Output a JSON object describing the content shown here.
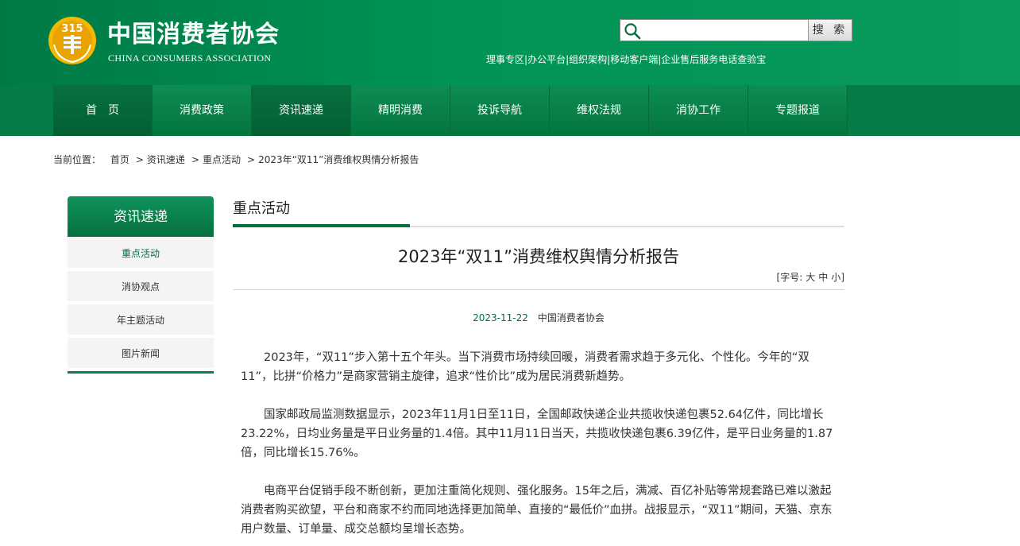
{
  "header": {
    "logo_cn": "中国消费者协会",
    "logo_en": "CHINA CONSUMERS ASSOCIATION",
    "search_placeholder": "",
    "search_button": "搜 索",
    "top_links": [
      "理事专区",
      "办公平台",
      "组织架构",
      "移动客户端",
      "企业售后服务电话查验宝"
    ],
    "separator": "|"
  },
  "nav": {
    "items": [
      "首　页",
      "消费政策",
      "资讯速递",
      "精明消费",
      "投诉导航",
      "维权法规",
      "消协工作",
      "专题报道"
    ],
    "active_index": 2
  },
  "breadcrumb": {
    "prefix": "当前位置：",
    "items": [
      "首页",
      "资讯速递",
      "重点活动",
      "2023年“双11”消费维权舆情分析报告"
    ],
    "separator": ">"
  },
  "sidebar": {
    "title": "资讯速递",
    "items": [
      "重点活动",
      "消协观点",
      "年主题活动",
      "图片新闻"
    ],
    "active_index": 0
  },
  "section": {
    "title": "重点活动"
  },
  "article": {
    "title": "2023年“双11”消费维权舆情分析报告",
    "font_size_label": "[字号:",
    "font_size_options": [
      "大",
      "中",
      "小"
    ],
    "font_size_close": "]",
    "date": "2023-11-22",
    "source": "中国消费者协会",
    "paragraphs": [
      "2023年，“双11”步入第十五个年头。当下消费市场持续回暖，消费者需求趋于多元化、个性化。今年的“双11”，比拼“价格力”是商家营销主旋律，追求“性价比”成为居民消费新趋势。",
      "国家邮政局监测数据显示，2023年11月1日至11日，全国邮政快递企业共揽收快递包裹52.64亿件，同比增长23.22%，日均业务量是平日业务量的1.4倍。其中11月11日当天，共揽收快递包裹6.39亿件，是平日业务量的1.87倍，同比增长15.76%。",
      "电商平台促销手段不断创新，更加注重简化规则、强化服务。15年之后，满减、百亿补贴等常规套路已难以激起消费者购买欲望，平台和商家不约而同地选择更加简单、直接的“最低价”血拼。战报显示，“双11”期间，天猫、京东用户数量、订单量、成交总额均呈增长态势。"
    ]
  },
  "colors": {
    "brand_green": "#009455",
    "nav_green": "#057c46",
    "accent_dark_green": "#00713c"
  }
}
